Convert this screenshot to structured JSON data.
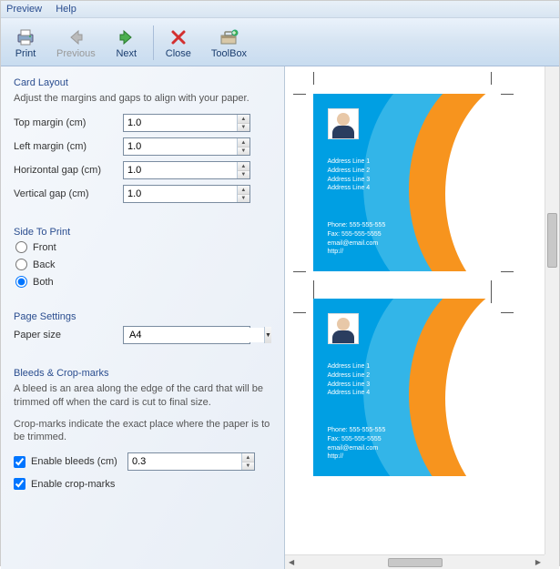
{
  "menu": {
    "preview": "Preview",
    "help": "Help"
  },
  "toolbar": {
    "print": "Print",
    "previous": "Previous",
    "next": "Next",
    "close": "Close",
    "toolbox": "ToolBox"
  },
  "layout": {
    "title": "Card Layout",
    "desc": "Adjust the margins and gaps to align with your paper.",
    "top_margin_label": "Top margin (cm)",
    "top_margin": "1.0",
    "left_margin_label": "Left margin (cm)",
    "left_margin": "1.0",
    "hgap_label": "Horizontal gap (cm)",
    "hgap": "1.0",
    "vgap_label": "Vertical gap (cm)",
    "vgap": "1.0"
  },
  "side": {
    "title": "Side To Print",
    "front": "Front",
    "back": "Back",
    "both": "Both",
    "selected": "both"
  },
  "page_settings": {
    "title": "Page Settings",
    "paper_label": "Paper size",
    "paper": "A4"
  },
  "bleeds": {
    "title": "Bleeds & Crop-marks",
    "desc1": "A bleed is an area along the edge of the card that will be trimmed off when the card is cut to final size.",
    "desc2": "Crop-marks indicate the exact place where the paper is to be trimmed.",
    "enable_bleeds_label": "Enable bleeds (cm)",
    "bleed_value": "0.3",
    "enable_crop_label": "Enable crop-marks"
  },
  "card": {
    "addr1": "Address Line 1",
    "addr2": "Address Line 2",
    "addr3": "Address Line 3",
    "addr4": "Address Line 4",
    "phone": "Phone: 555-555-555",
    "fax": "Fax: 555-555-5555",
    "email": "email@email.com",
    "http": "http://"
  }
}
